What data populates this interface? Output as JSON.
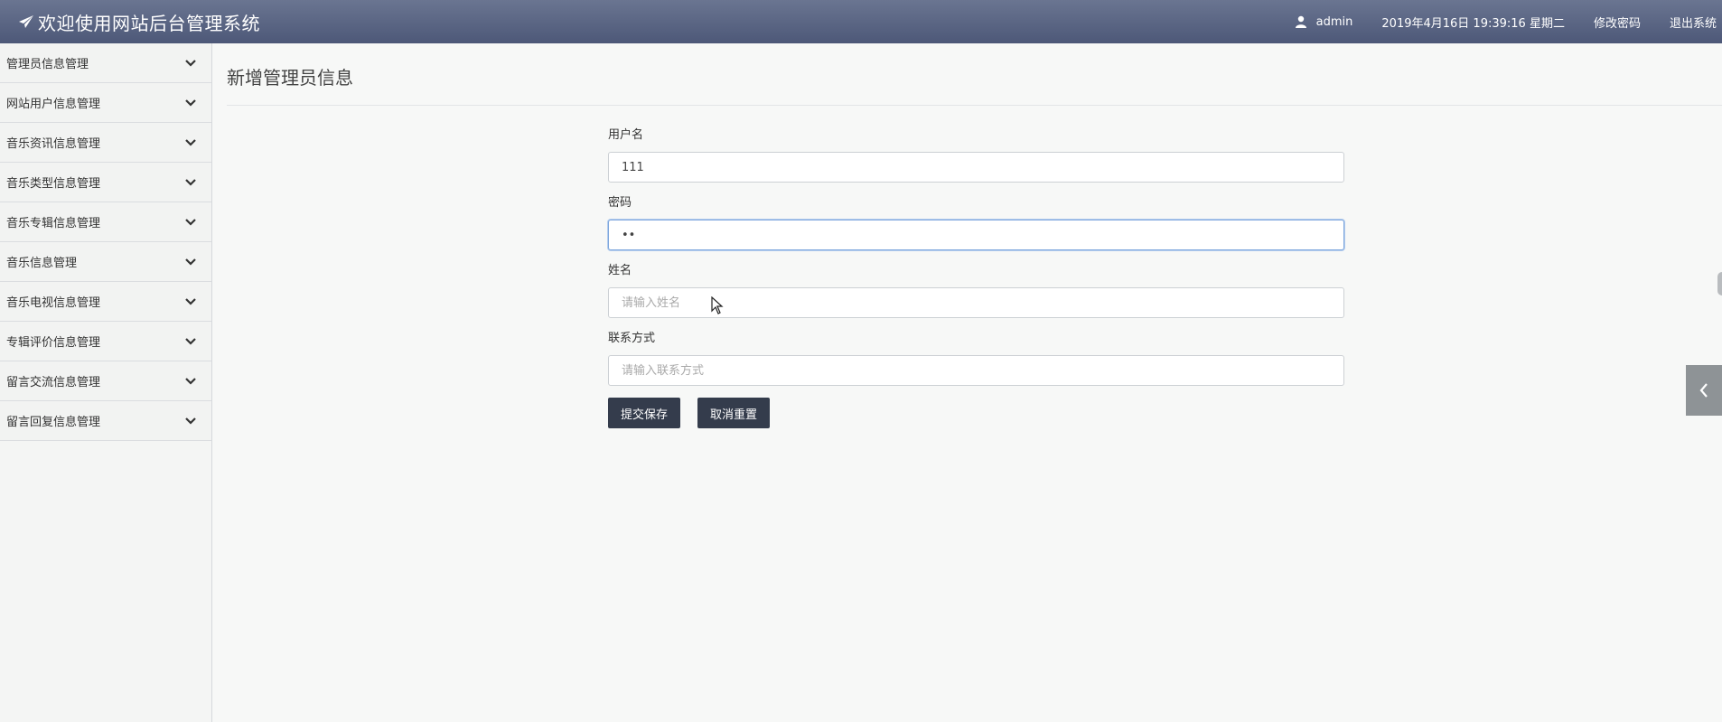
{
  "header": {
    "title": "欢迎使用网站后台管理系统",
    "username": "admin",
    "datetime": "2019年4月16日 19:39:16 星期二",
    "change_password": "修改密码",
    "logout": "退出系统"
  },
  "sidebar": {
    "items": [
      {
        "label": "管理员信息管理"
      },
      {
        "label": "网站用户信息管理"
      },
      {
        "label": "音乐资讯信息管理"
      },
      {
        "label": "音乐类型信息管理"
      },
      {
        "label": "音乐专辑信息管理"
      },
      {
        "label": "音乐信息管理"
      },
      {
        "label": "音乐电视信息管理"
      },
      {
        "label": "专辑评价信息管理"
      },
      {
        "label": "留言交流信息管理"
      },
      {
        "label": "留言回复信息管理"
      }
    ]
  },
  "main": {
    "title": "新增管理员信息",
    "fields": {
      "username": {
        "label": "用户名",
        "value": "111"
      },
      "password": {
        "label": "密码",
        "value": "••"
      },
      "name": {
        "label": "姓名",
        "placeholder": "请输入姓名"
      },
      "contact": {
        "label": "联系方式",
        "placeholder": "请输入联系方式"
      }
    },
    "submit_label": "提交保存",
    "reset_label": "取消重置"
  },
  "icons": {
    "brand": "paper-plane-icon",
    "user": "user-icon",
    "chevron": "chevron-down-icon",
    "drawer": "chevron-left-icon"
  },
  "colors": {
    "topbar": "#5a6584",
    "button": "#343c4c",
    "focus": "#7ea7dd"
  }
}
